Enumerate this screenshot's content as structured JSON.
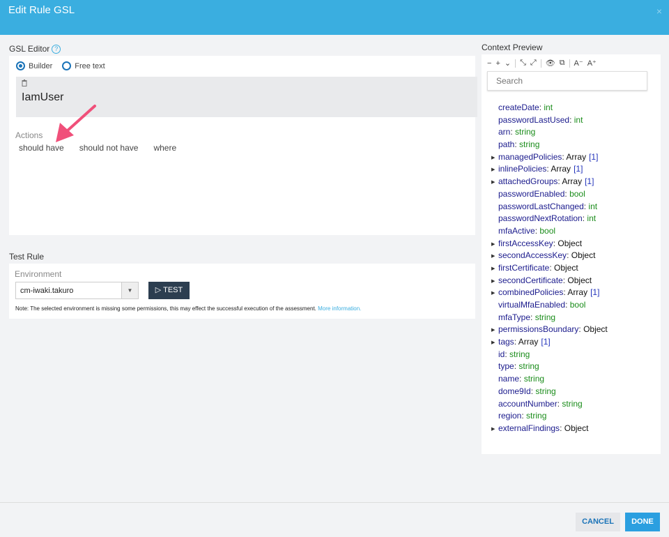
{
  "header": {
    "title": "Edit Rule GSL",
    "close_glyph": "×"
  },
  "gsl_editor": {
    "label": "GSL Editor",
    "help_glyph": "?",
    "modes": [
      {
        "label": "Builder",
        "selected": true
      },
      {
        "label": "Free text",
        "selected": false
      }
    ],
    "entity": "IamUser",
    "trash_glyph": "🗑",
    "actions_label": "Actions",
    "actions": [
      "should have",
      "should not have",
      "where"
    ]
  },
  "test_rule": {
    "label": "Test Rule",
    "environment_label": "Environment",
    "environment_value": "cm-iwaki.takuro",
    "test_button": "TEST",
    "note": "Note: The selected environment is missing some permissions, this may effect the successful execution of the assessment.",
    "more_info": "More information."
  },
  "context_preview": {
    "label": "Context Preview",
    "toolbar": [
      "−",
      "+",
      "⌄",
      "⤡",
      "⤢",
      "👁",
      "⧉",
      "A⁻",
      "A⁺"
    ],
    "search_placeholder": "Search",
    "fields": [
      {
        "key": "createDate",
        "type": "int",
        "expandable": false
      },
      {
        "key": "passwordLastUsed",
        "type": "int",
        "expandable": false
      },
      {
        "key": "arn",
        "type": "string",
        "expandable": false
      },
      {
        "key": "path",
        "type": "string",
        "expandable": false
      },
      {
        "key": "managedPolicies",
        "type": "Array",
        "count": "[1]",
        "expandable": true
      },
      {
        "key": "inlinePolicies",
        "type": "Array",
        "count": "[1]",
        "expandable": true
      },
      {
        "key": "attachedGroups",
        "type": "Array",
        "count": "[1]",
        "expandable": true
      },
      {
        "key": "passwordEnabled",
        "type": "bool",
        "expandable": false
      },
      {
        "key": "passwordLastChanged",
        "type": "int",
        "expandable": false
      },
      {
        "key": "passwordNextRotation",
        "type": "int",
        "expandable": false
      },
      {
        "key": "mfaActive",
        "type": "bool",
        "expandable": false
      },
      {
        "key": "firstAccessKey",
        "type": "Object",
        "expandable": true
      },
      {
        "key": "secondAccessKey",
        "type": "Object",
        "expandable": true
      },
      {
        "key": "firstCertificate",
        "type": "Object",
        "expandable": true
      },
      {
        "key": "secondCertificate",
        "type": "Object",
        "expandable": true
      },
      {
        "key": "combinedPolicies",
        "type": "Array",
        "count": "[1]",
        "expandable": true
      },
      {
        "key": "virtualMfaEnabled",
        "type": "bool",
        "expandable": false
      },
      {
        "key": "mfaType",
        "type": "string",
        "expandable": false
      },
      {
        "key": "permissionsBoundary",
        "type": "Object",
        "expandable": true
      },
      {
        "key": "tags",
        "type": "Array",
        "count": "[1]",
        "expandable": true
      },
      {
        "key": "id",
        "type": "string",
        "expandable": false
      },
      {
        "key": "type",
        "type": "string",
        "expandable": false
      },
      {
        "key": "name",
        "type": "string",
        "expandable": false
      },
      {
        "key": "dome9Id",
        "type": "string",
        "expandable": false
      },
      {
        "key": "accountNumber",
        "type": "string",
        "expandable": false
      },
      {
        "key": "region",
        "type": "string",
        "expandable": false
      },
      {
        "key": "externalFindings",
        "type": "Object",
        "expandable": true
      }
    ]
  },
  "footer": {
    "cancel": "CANCEL",
    "done": "DONE"
  },
  "colors": {
    "header": "#3aaee0",
    "accent": "#1a73b8",
    "annotation_arrow": "#f0507a",
    "test_button": "#2c3e50"
  }
}
